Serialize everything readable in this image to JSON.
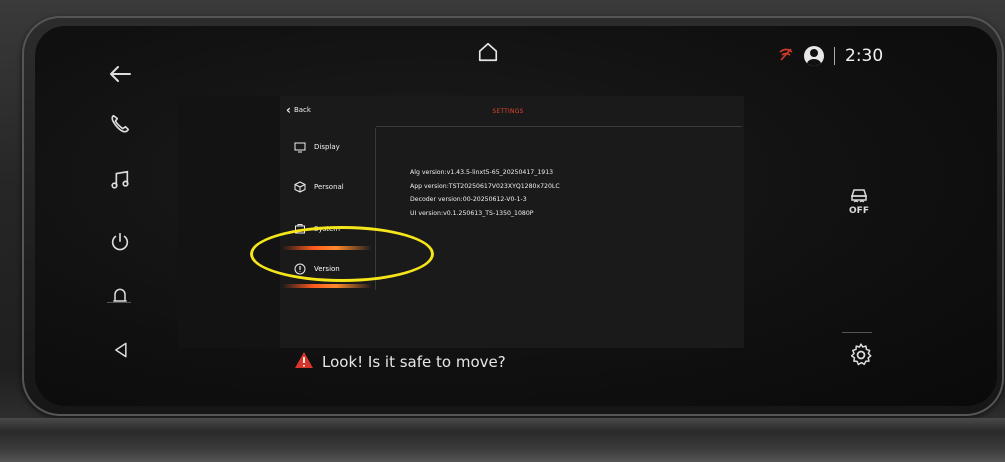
{
  "status": {
    "time": "2:30"
  },
  "icons": {
    "back": "back-arrow-icon",
    "phone": "phone-icon",
    "music": "music-note-icon",
    "power": "power-icon",
    "bell": "bell-icon",
    "volume": "volume-icon",
    "home": "home-icon",
    "wifi_off": "wifi-off-icon",
    "profile": "profile-icon",
    "traction": "traction-control-off-icon",
    "gear": "gear-icon",
    "warning": "warning-triangle-icon"
  },
  "right_bar": {
    "traction_label": "OFF"
  },
  "settings": {
    "back_label": "Back",
    "title": "SETTINGS",
    "menu": [
      {
        "label": "Display"
      },
      {
        "label": "Personal"
      },
      {
        "label": "System"
      },
      {
        "label": "Version"
      }
    ],
    "version_lines": [
      "Alg version:v1.43.5-linxt5-65_20250417_1913",
      "App version:TST20250617V023XYQ1280x720LC",
      "Decoder version:00-20250612-V0-1-3",
      "UI version:v0.1.250613_TS-1350_1080P"
    ]
  },
  "warning": {
    "text": "Look! Is it safe to move?"
  },
  "colors": {
    "accent": "#e0452f",
    "highlight": "#f5e51b",
    "warning": "#d8352a"
  }
}
